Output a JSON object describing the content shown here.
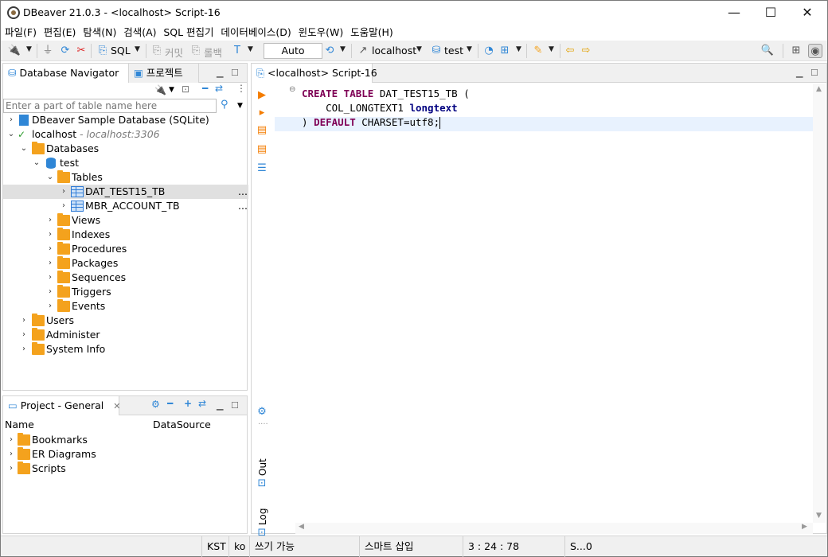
{
  "window": {
    "title": "DBeaver 21.0.3 - <localhost> Script-16",
    "minimize": "—",
    "maximize": "☐",
    "close": "✕"
  },
  "menu": [
    "파일(F)",
    "편집(E)",
    "탐색(N)",
    "검색(A)",
    "SQL 편집기",
    "데이터베이스(D)",
    "윈도우(W)",
    "도움말(H)"
  ],
  "toolbar": {
    "sql_label": "SQL",
    "commit_label": "커밋",
    "rollback_label": "롤백",
    "transaction_mode": "Auto",
    "datasource": "localhost",
    "schema": "test"
  },
  "navigator": {
    "tab_label": "Database Navigator",
    "projects_tab_label": "프로젝트",
    "filter_placeholder": "Enter a part of table name here",
    "items": [
      {
        "label": "DBeaver Sample Database (SQLite)",
        "icon": "sqlite-db-icon",
        "level": 0,
        "expanded": false
      },
      {
        "label": "localhost",
        "suffix": "- localhost:3306",
        "icon": "connection-icon",
        "level": 0,
        "expanded": true
      },
      {
        "label": "Databases",
        "icon": "databases-folder-icon",
        "level": 1,
        "expanded": true
      },
      {
        "label": "test",
        "icon": "database-icon",
        "level": 2,
        "expanded": true
      },
      {
        "label": "Tables",
        "icon": "tables-folder-icon",
        "level": 3,
        "expanded": true
      },
      {
        "label": "DAT_TEST15_TB",
        "icon": "table-icon",
        "level": 4,
        "expanded": false,
        "selected": true,
        "more": "..."
      },
      {
        "label": "MBR_ACCOUNT_TB",
        "icon": "table-icon",
        "level": 4,
        "expanded": false,
        "more": "..."
      },
      {
        "label": "Views",
        "icon": "views-icon",
        "level": 3,
        "expanded": false
      },
      {
        "label": "Indexes",
        "icon": "folder-icon",
        "level": 3,
        "expanded": false
      },
      {
        "label": "Procedures",
        "icon": "folder-icon",
        "level": 3,
        "expanded": false
      },
      {
        "label": "Packages",
        "icon": "folder-icon",
        "level": 3,
        "expanded": false
      },
      {
        "label": "Sequences",
        "icon": "folder-icon",
        "level": 3,
        "expanded": false
      },
      {
        "label": "Triggers",
        "icon": "folder-icon",
        "level": 3,
        "expanded": false
      },
      {
        "label": "Events",
        "icon": "folder-icon",
        "level": 3,
        "expanded": false
      },
      {
        "label": "Users",
        "icon": "users-icon",
        "level": 1,
        "expanded": false
      },
      {
        "label": "Administer",
        "icon": "administer-icon",
        "level": 1,
        "expanded": false
      },
      {
        "label": "System Info",
        "icon": "info-icon",
        "level": 1,
        "expanded": false
      }
    ]
  },
  "project": {
    "tab_label": "Project - General",
    "col_name": "Name",
    "col_datasource": "DataSource",
    "items": [
      "Bookmarks",
      "ER Diagrams",
      "Scripts"
    ]
  },
  "editor": {
    "tab_label": "<localhost> Script-16",
    "code": {
      "line1_kw": "CREATE TABLE",
      "line1_rest": " DAT_TEST15_TB (",
      "line2_col": "    COL_LONGTEXT1 ",
      "line2_type": "longtext",
      "line3_a": ") ",
      "line3_kw": "DEFAULT",
      "line3_rest": " CHARSET=utf8;"
    },
    "side_out": "Out",
    "side_log": "Log"
  },
  "status": {
    "tz": "KST",
    "lang": "ko",
    "mode": "쓰기 가능",
    "insert": "스마트 삽입",
    "position": "3 : 24 : 78",
    "extra": "S...0"
  },
  "colors": {
    "keyword": "#7f0055",
    "type_keyword": "#000080",
    "folder": "#f4a21d",
    "accent": "#2f86d6"
  }
}
